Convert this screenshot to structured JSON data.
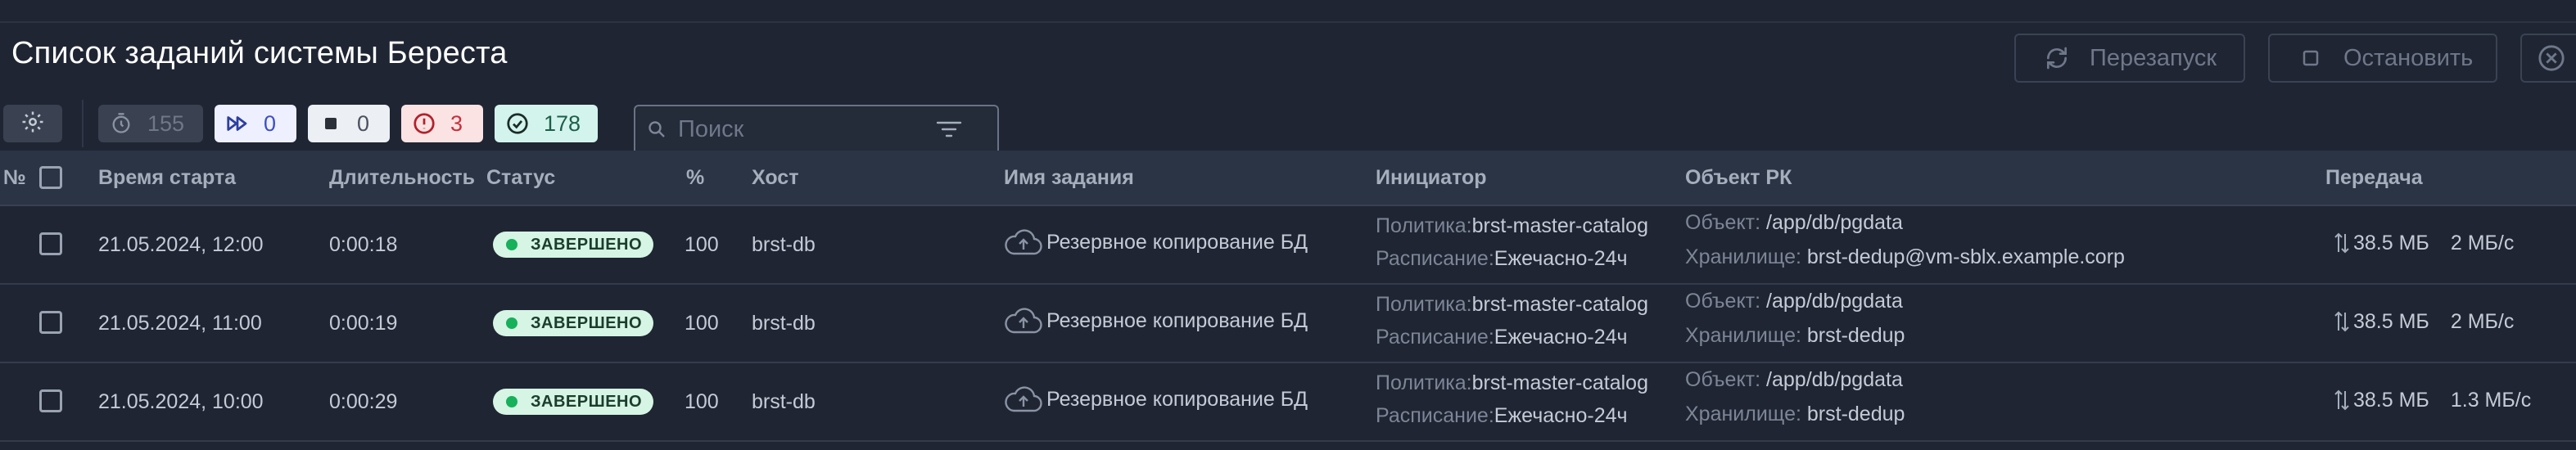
{
  "header": {
    "title": "Список заданий системы Береста",
    "restart_label": "Перезапуск",
    "stop_label": "Остановить"
  },
  "toolbar": {
    "counters": {
      "timer": "155",
      "running": "0",
      "stopped": "0",
      "errors": "3",
      "done": "178"
    },
    "search_placeholder": "Поиск"
  },
  "table": {
    "columns": {
      "num": "№",
      "start": "Время старта",
      "duration": "Длительность",
      "status": "Статус",
      "percent": "%",
      "host": "Хост",
      "job": "Имя задания",
      "initiator": "Инициатор",
      "object": "Объект РК",
      "transfer": "Передача"
    },
    "policy_label": "Политика:",
    "schedule_label": "Расписание:",
    "object_label": "Объект:",
    "storage_label": "Хранилище:",
    "rows": [
      {
        "start": "21.05.2024, 12:00",
        "duration": "0:00:18",
        "status": "ЗАВЕРШЕНО",
        "percent": "100",
        "host": "brst-db",
        "job": "Резервное копирование БД",
        "policy": "brst-master-catalog",
        "schedule": "Ежечасно-24ч",
        "object": "/app/db/pgdata",
        "storage": "brst-dedup@vm-sblx.example.corp",
        "size": "38.5 МБ",
        "speed": "2 МБ/с"
      },
      {
        "start": "21.05.2024, 11:00",
        "duration": "0:00:19",
        "status": "ЗАВЕРШЕНО",
        "percent": "100",
        "host": "brst-db",
        "job": "Резервное копирование БД",
        "policy": "brst-master-catalog",
        "schedule": "Ежечасно-24ч",
        "object": "/app/db/pgdata",
        "storage": "brst-dedup",
        "size": "38.5 МБ",
        "speed": "2 МБ/с"
      },
      {
        "start": "21.05.2024, 10:00",
        "duration": "0:00:29",
        "status": "ЗАВЕРШЕНО",
        "percent": "100",
        "host": "brst-db",
        "job": "Резервное копирование БД",
        "policy": "brst-master-catalog",
        "schedule": "Ежечасно-24ч",
        "object": "/app/db/pgdata",
        "storage": "brst-dedup",
        "size": "38.5 МБ",
        "speed": "1.3 МБ/с"
      }
    ]
  },
  "colors": {
    "background": "#1f2533",
    "header_row": "#2a3444",
    "status_badge": "#d6f5e4",
    "status_dot": "#16b15a",
    "error_chip": "#fbe3e4",
    "done_chip": "#d3f4ec",
    "running_chip": "#eef0ff"
  },
  "icons": [
    "restart-icon",
    "stop-icon",
    "close-icon",
    "gear-icon",
    "timer-icon",
    "fast-forward-icon",
    "stop-square-icon",
    "error-icon",
    "check-circle-icon",
    "search-icon",
    "filter-icon",
    "cloud-upload-icon",
    "transfer-arrows-icon"
  ]
}
